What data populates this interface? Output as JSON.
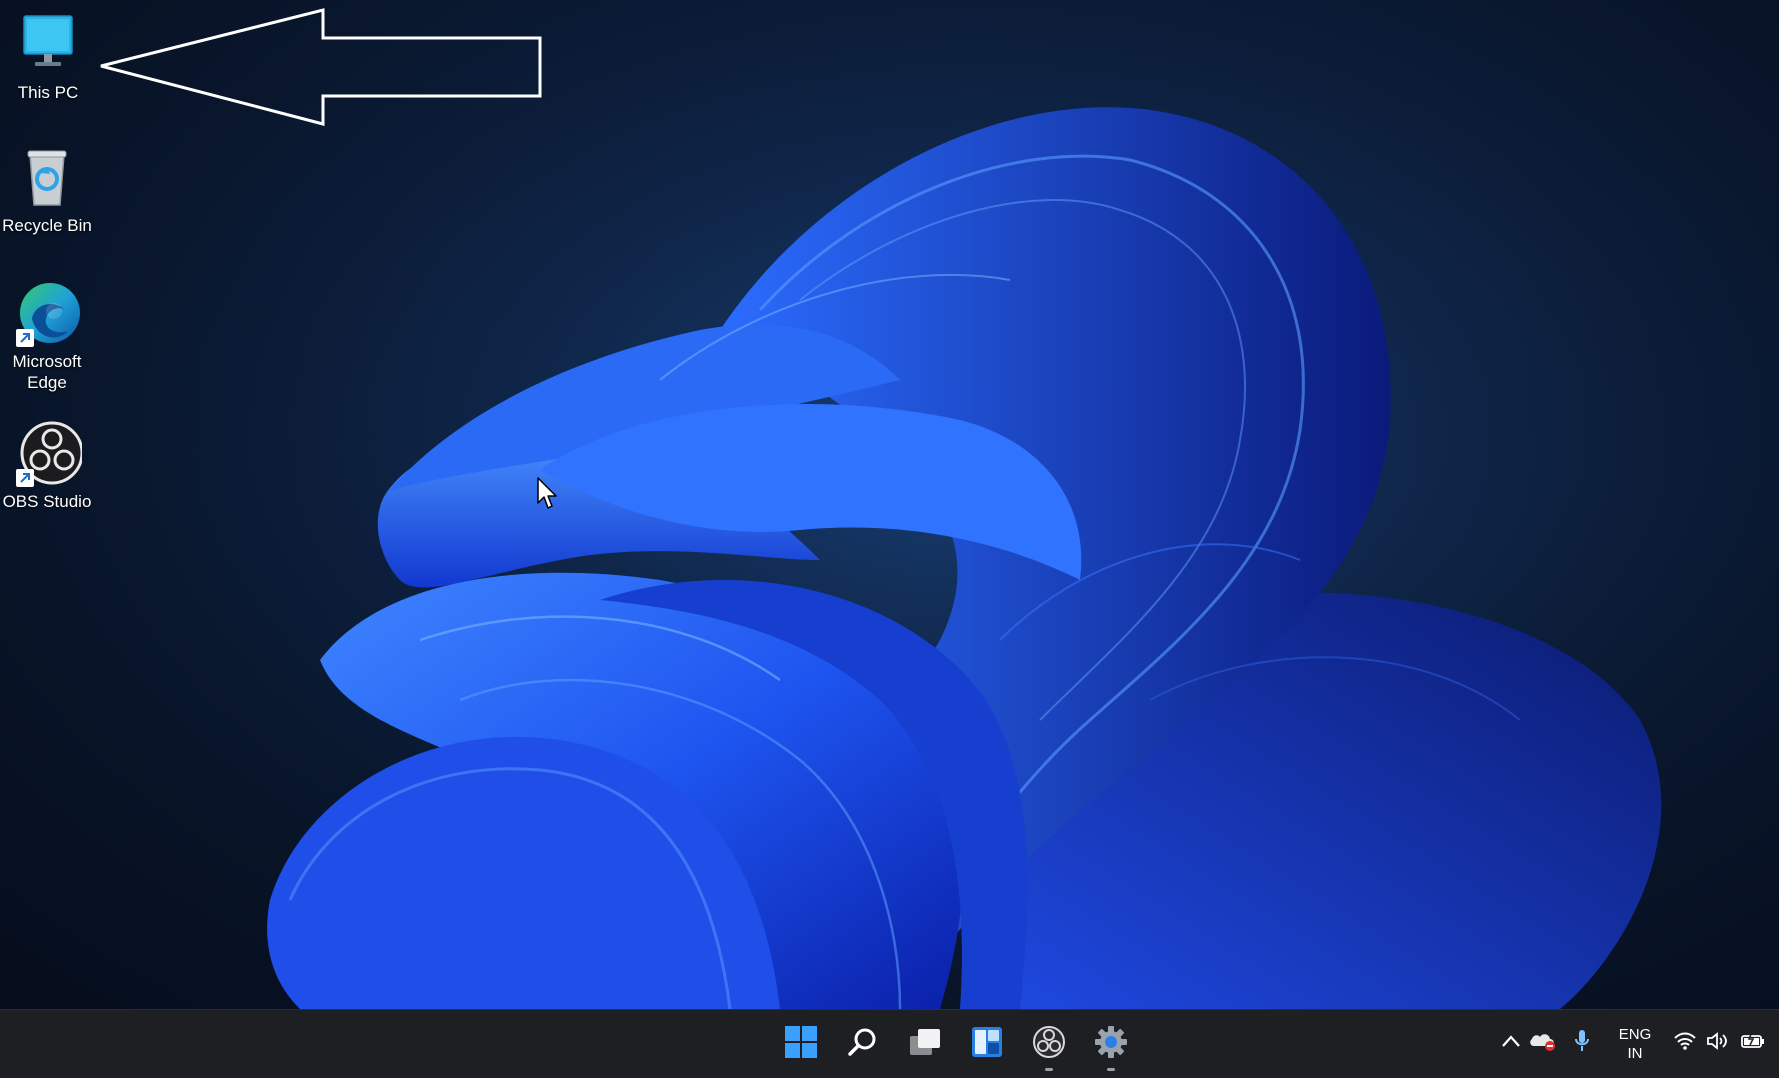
{
  "desktop": {
    "icons": [
      {
        "label": "This PC",
        "icon": "monitor-icon"
      },
      {
        "label": "Recycle Bin",
        "icon": "recycle-bin-icon"
      },
      {
        "label": "Microsoft Edge",
        "icon": "edge-icon"
      },
      {
        "label": "OBS Studio",
        "icon": "obs-icon"
      }
    ],
    "annotation": "arrow-outline"
  },
  "taskbar": {
    "pinned": [
      {
        "name": "start",
        "icon": "windows-logo-icon"
      },
      {
        "name": "search",
        "icon": "search-icon"
      },
      {
        "name": "task-view",
        "icon": "task-view-icon"
      },
      {
        "name": "widgets",
        "icon": "widgets-icon"
      },
      {
        "name": "obs-studio",
        "icon": "obs-icon"
      },
      {
        "name": "settings",
        "icon": "gear-icon"
      }
    ],
    "tray": {
      "language_line1": "ENG",
      "language_line2": "IN",
      "icons": [
        "chevron-up-icon",
        "onedrive-icon",
        "microphone-icon",
        "wifi-icon",
        "volume-icon",
        "battery-icon"
      ]
    }
  },
  "colors": {
    "accent": "#1f5fff",
    "taskbar_bg": "#1e1f22",
    "desktop_bg": "#0a1628"
  }
}
